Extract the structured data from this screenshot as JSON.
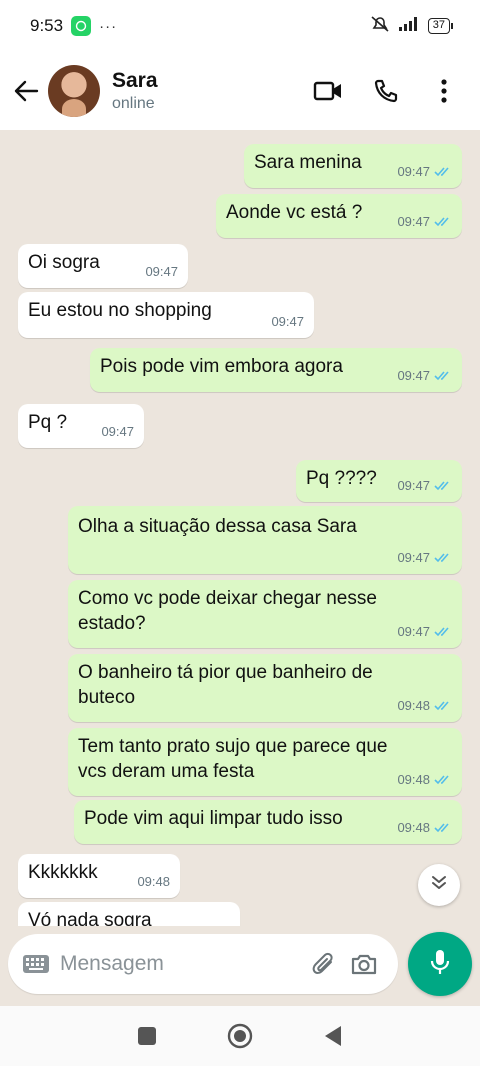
{
  "status_bar": {
    "time": "9:53",
    "battery": "37",
    "overflow": "···"
  },
  "header": {
    "name": "Sara",
    "status": "online"
  },
  "messages": [
    {
      "dir": "out",
      "text": "Sara menina",
      "time": "09:47"
    },
    {
      "dir": "out",
      "text": "Aonde vc está ?",
      "time": "09:47"
    },
    {
      "dir": "in",
      "text": "Oi sogra",
      "time": "09:47"
    },
    {
      "dir": "in",
      "text": "Eu estou no shopping",
      "time": "09:47"
    },
    {
      "dir": "out",
      "text": "Pois pode vim embora agora",
      "time": "09:47"
    },
    {
      "dir": "in",
      "text": "Pq ?",
      "time": "09:47"
    },
    {
      "dir": "out",
      "text": "Pq ????",
      "time": "09:47"
    },
    {
      "dir": "out",
      "text": "Olha a situação dessa casa Sara",
      "time": "09:47"
    },
    {
      "dir": "out",
      "text": "Como vc pode deixar chegar nesse estado?",
      "time": "09:47"
    },
    {
      "dir": "out",
      "text": "O banheiro tá pior que banheiro de buteco",
      "time": "09:48"
    },
    {
      "dir": "out",
      "text": "Tem tanto prato sujo que parece que vcs deram uma festa",
      "time": "09:48"
    },
    {
      "dir": "out",
      "text": "Pode vim aqui limpar tudo isso",
      "time": "09:48"
    },
    {
      "dir": "in",
      "text": "Kkkkkkk",
      "time": "09:48"
    },
    {
      "dir": "in",
      "text": "Vó nada sogra",
      "time": ""
    }
  ],
  "composer": {
    "placeholder": "Mensagem"
  },
  "colors": {
    "outgoing": "#dcf8c6",
    "incoming": "#ffffff",
    "accent": "#00a884",
    "tick": "#53bdeb"
  },
  "icons": [
    "back-arrow-icon",
    "video-call-icon",
    "voice-call-icon",
    "more-icon",
    "keyboard-icon",
    "attach-icon",
    "camera-icon",
    "mic-icon",
    "double-check-icon",
    "chevron-down-icon",
    "square-icon",
    "circle-icon",
    "triangle-back-icon"
  ]
}
